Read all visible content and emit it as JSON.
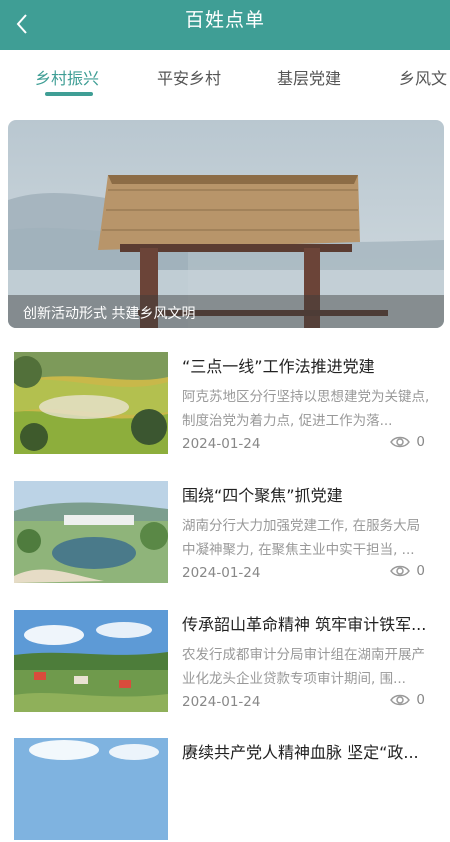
{
  "header": {
    "title": "百姓点单",
    "back_icon": "chevron-left-icon"
  },
  "tabs": [
    {
      "label": "乡村振兴",
      "active": true
    },
    {
      "label": "平安乡村",
      "active": false
    },
    {
      "label": "基层党建",
      "active": false
    },
    {
      "label": "乡风文",
      "active": false
    }
  ],
  "colors": {
    "accent": "#3f9e95"
  },
  "banner": {
    "caption": "创新活动形式 共建乡风文明"
  },
  "articles": [
    {
      "title": "“三点一线”工作法推进党建",
      "summary": "阿克苏地区分行坚持以思想建党为关键点, 制度治党为着力点, 促进工作为落...",
      "date": "2024-01-24",
      "views": "0"
    },
    {
      "title": "围绕“四个聚焦”抓党建",
      "summary": "湖南分行大力加强党建工作, 在服务大局中凝神聚力, 在聚焦主业中实干担当, ...",
      "date": "2024-01-24",
      "views": "0"
    },
    {
      "title": "传承韶山革命精神 筑牢审计铁军...",
      "summary": "农发行成都审计分局审计组在湖南开展产业化龙头企业贷款专项审计期间, 围...",
      "date": "2024-01-24",
      "views": "0"
    },
    {
      "title": "赓续共产党人精神血脉 坚定“政..."
    }
  ]
}
